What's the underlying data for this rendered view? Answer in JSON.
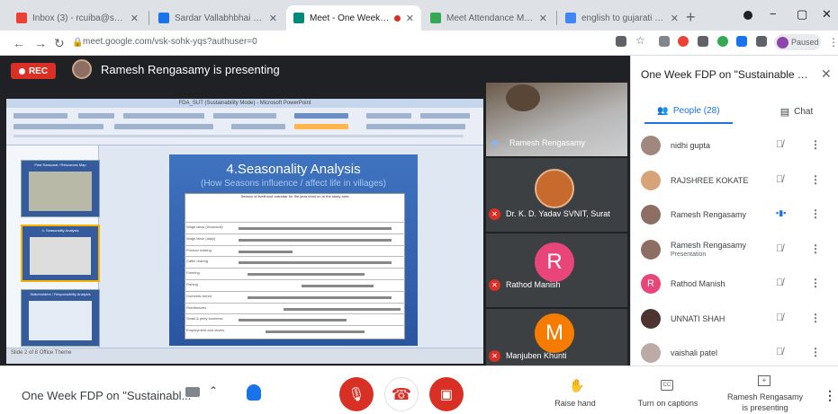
{
  "browser": {
    "tabs": [
      {
        "title": "Inbox (3) - rcuiba@svnit.ac.in",
        "favicon_color": "#ea4335",
        "active": false
      },
      {
        "title": "Sardar Vallabhbhai National",
        "favicon_color": "#1a73e8",
        "active": false
      },
      {
        "title": "Meet - One Week FDP o",
        "favicon_color": "#00897b",
        "active": true
      },
      {
        "title": "Meet Attendance Monitor",
        "favicon_color": "#34a853",
        "active": false
      },
      {
        "title": "english to gujarati - Google",
        "favicon_color": "#4285f4",
        "active": false
      }
    ],
    "tab_close": "✕",
    "new_tab": "+",
    "minimize": "−",
    "maximize": "▢",
    "close": "✕",
    "url": "meet.google.com/vsk-sohk-yqs?authuser=0",
    "profile_label": "Paused"
  },
  "meeting": {
    "rec_label": "REC",
    "presenting_text": "Ramesh Rengasamy is presenting",
    "meeting_name": "One Week FDP on \"Sustainabl...",
    "slide": {
      "window_title": "FDA_SUT (Sustainability Mode) - Microsoft PowerPoint",
      "title": "4.Seasonality Analysis",
      "subtitle": "(How Seasons influence / affect life in villages)",
      "table_caption": "Season of livelihood calendar for the year chart on In the study area",
      "rows": [
        "Wage labor (Seasonal)",
        "Wage labor (daily)",
        "Product making",
        "Cattle rearing",
        "Farming",
        "Fishing",
        "Domestic bored",
        "Remittances",
        "Small & petty business",
        "Employment and others"
      ],
      "thumbs": [
        "Past Seasonal / Resources Map",
        "4. Seasonality Analysis",
        "Stakeholders / Responsibility Analysis"
      ],
      "statusbar": "Slide 2 of 8   Office Theme"
    },
    "tiles": [
      {
        "name": "Ramesh Rengasamy",
        "muted": false
      },
      {
        "name": "Dr. K. D. Yadav SVNIT, Surat",
        "muted": true
      },
      {
        "name": "Rathod Manish",
        "initial": "R",
        "color": "#e8457a",
        "muted": true
      },
      {
        "name": "Manjuben Khunti",
        "initial": "M",
        "color": "#f57c00",
        "muted": true
      }
    ]
  },
  "panel": {
    "title": "One Week FDP on \"Sustainable Te...",
    "people_tab": "People (28)",
    "chat_tab": "Chat",
    "participants": [
      {
        "name": "nidhi gupta",
        "sub": "",
        "color": "#a1887f",
        "initial": "",
        "mic": "muted"
      },
      {
        "name": "RAJSHREE KOKATE",
        "sub": "",
        "color": "#d7a47a",
        "initial": "",
        "mic": "muted"
      },
      {
        "name": "Ramesh Rengasamy",
        "sub": "",
        "color": "#8d6e63",
        "initial": "",
        "mic": "talking"
      },
      {
        "name": "Ramesh Rengasamy",
        "sub": "Presentation",
        "color": "#8d6e63",
        "initial": "",
        "mic": "muted"
      },
      {
        "name": "Rathod Manish",
        "sub": "",
        "color": "#e8457a",
        "initial": "R",
        "mic": "muted"
      },
      {
        "name": "UNNATI SHAH",
        "sub": "",
        "color": "#4e342e",
        "initial": "",
        "mic": "muted"
      },
      {
        "name": "vaishali patel",
        "sub": "",
        "color": "#bcaaa4",
        "initial": "",
        "mic": "muted"
      }
    ]
  },
  "controls": {
    "raise_hand": "Raise hand",
    "captions": "Turn on captions",
    "presenting_line1": "Ramesh Rengasamy",
    "presenting_line2": "is presenting"
  },
  "colors": {
    "accent": "#1a73e8",
    "danger": "#d93025"
  }
}
